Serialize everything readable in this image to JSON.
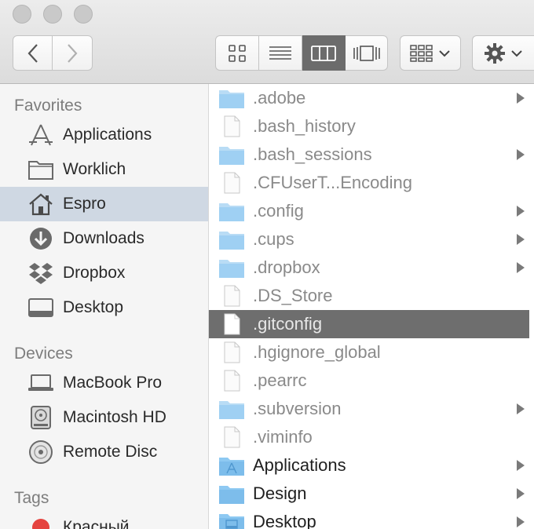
{
  "toolbar": {
    "traffic_lights": [
      "close",
      "minimize",
      "zoom"
    ],
    "nav": {
      "back_icon": "chevron-left-icon",
      "forward_icon": "chevron-right-icon"
    },
    "view_modes": [
      {
        "icon": "icon-view-icon",
        "active": false
      },
      {
        "icon": "list-view-icon",
        "active": false
      },
      {
        "icon": "column-view-icon",
        "active": true
      },
      {
        "icon": "cover-flow-icon",
        "active": false
      }
    ],
    "arrange_icon": "arrange-grid-icon",
    "action_icon": "gear-icon"
  },
  "sidebar": {
    "favorites_heading": "Favorites",
    "favorites": [
      {
        "label": "Applications",
        "icon": "applications-icon"
      },
      {
        "label": "Worklich",
        "icon": "folder-icon"
      },
      {
        "label": "Espro",
        "icon": "home-icon",
        "selected": true
      },
      {
        "label": "Downloads",
        "icon": "downloads-icon"
      },
      {
        "label": "Dropbox",
        "icon": "dropbox-icon"
      },
      {
        "label": "Desktop",
        "icon": "desktop-icon"
      }
    ],
    "devices_heading": "Devices",
    "devices": [
      {
        "label": "MacBook Pro",
        "icon": "laptop-icon"
      },
      {
        "label": "Macintosh HD",
        "icon": "hard-drive-icon"
      },
      {
        "label": "Remote Disc",
        "icon": "disc-icon"
      }
    ],
    "tags_heading": "Tags",
    "tags": [
      {
        "label": "Красный",
        "color": "#e5433f"
      }
    ]
  },
  "files": [
    {
      "name": ".adobe",
      "type": "folder",
      "hidden": true,
      "has_children": true
    },
    {
      "name": ".bash_history",
      "type": "file",
      "hidden": true,
      "has_children": false
    },
    {
      "name": ".bash_sessions",
      "type": "folder",
      "hidden": true,
      "has_children": true
    },
    {
      "name": ".CFUserT...Encoding",
      "type": "file",
      "hidden": true,
      "has_children": false
    },
    {
      "name": ".config",
      "type": "folder",
      "hidden": true,
      "has_children": true
    },
    {
      "name": ".cups",
      "type": "folder",
      "hidden": true,
      "has_children": true
    },
    {
      "name": ".dropbox",
      "type": "folder",
      "hidden": true,
      "has_children": true
    },
    {
      "name": ".DS_Store",
      "type": "file",
      "hidden": true,
      "has_children": false
    },
    {
      "name": ".gitconfig",
      "type": "file",
      "hidden": true,
      "has_children": false,
      "selected": true
    },
    {
      "name": ".hgignore_global",
      "type": "file",
      "hidden": true,
      "has_children": false
    },
    {
      "name": ".pearrc",
      "type": "file",
      "hidden": true,
      "has_children": false
    },
    {
      "name": ".subversion",
      "type": "folder",
      "hidden": true,
      "has_children": true
    },
    {
      "name": ".viminfo",
      "type": "file",
      "hidden": true,
      "has_children": false
    },
    {
      "name": "Applications",
      "type": "applications-folder",
      "hidden": false,
      "has_children": true
    },
    {
      "name": "Design",
      "type": "folder",
      "hidden": false,
      "has_children": true
    },
    {
      "name": "Desktop",
      "type": "desktop-folder",
      "hidden": false,
      "has_children": true
    }
  ],
  "colors": {
    "folder_blue": "#8ec9f2",
    "selection_gray": "#6e6e6e",
    "sidebar_selected": "#cfd8e3"
  }
}
